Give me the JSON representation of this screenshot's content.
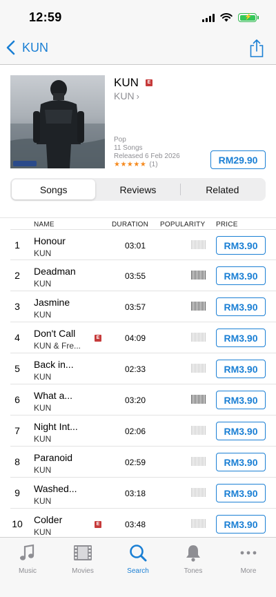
{
  "status": {
    "time": "12:59"
  },
  "nav": {
    "back_label": "KUN"
  },
  "album": {
    "title": "KUN",
    "explicit_label": "E",
    "artist": "KUN",
    "genre": "Pop",
    "song_count": "11 Songs",
    "released": "Released 6 Feb 2026",
    "stars": "★★★★★",
    "rating_count": "(1)",
    "price": "RM29.90"
  },
  "segments": [
    {
      "label": "Songs",
      "active": true
    },
    {
      "label": "Reviews",
      "active": false
    },
    {
      "label": "Related",
      "active": false
    }
  ],
  "table": {
    "columns": {
      "name": "NAME",
      "duration": "DURATION",
      "popularity": "POPULARITY",
      "price": "PRICE"
    },
    "rows": [
      {
        "num": "1",
        "title": "Honour",
        "artist": "KUN",
        "explicit": false,
        "duration": "03:01",
        "popularity": 0.0,
        "price": "RM3.90"
      },
      {
        "num": "2",
        "title": "Deadman",
        "artist": "KUN",
        "explicit": false,
        "duration": "03:55",
        "popularity": 1.0,
        "price": "RM3.90"
      },
      {
        "num": "3",
        "title": "Jasmine",
        "artist": "KUN",
        "explicit": false,
        "duration": "03:57",
        "popularity": 1.0,
        "price": "RM3.90"
      },
      {
        "num": "4",
        "title": "Don't Call",
        "artist": "KUN & Fre...",
        "explicit": true,
        "duration": "04:09",
        "popularity": 0.0,
        "price": "RM3.90"
      },
      {
        "num": "5",
        "title": "Back in...",
        "artist": "KUN",
        "explicit": false,
        "duration": "02:33",
        "popularity": 0.0,
        "price": "RM3.90"
      },
      {
        "num": "6",
        "title": "What a...",
        "artist": "KUN",
        "explicit": false,
        "duration": "03:20",
        "popularity": 1.0,
        "price": "RM3.90"
      },
      {
        "num": "7",
        "title": "Night Int...",
        "artist": "KUN",
        "explicit": false,
        "duration": "02:06",
        "popularity": 0.0,
        "price": "RM3.90"
      },
      {
        "num": "8",
        "title": "Paranoid",
        "artist": "KUN",
        "explicit": false,
        "duration": "02:59",
        "popularity": 0.0,
        "price": "RM3.90"
      },
      {
        "num": "9",
        "title": "Washed...",
        "artist": "KUN",
        "explicit": false,
        "duration": "03:18",
        "popularity": 0.0,
        "price": "RM3.90"
      },
      {
        "num": "10",
        "title": "Colder",
        "artist": "KUN",
        "explicit": true,
        "duration": "03:48",
        "popularity": 0.0,
        "price": "RM3.90"
      }
    ]
  },
  "tabbar": [
    {
      "label": "Music",
      "icon": "music-note-icon",
      "active": false
    },
    {
      "label": "Movies",
      "icon": "film-icon",
      "active": false
    },
    {
      "label": "Search",
      "icon": "search-icon",
      "active": true
    },
    {
      "label": "Tones",
      "icon": "bell-icon",
      "active": false
    },
    {
      "label": "More",
      "icon": "more-icon",
      "active": false
    }
  ],
  "colors": {
    "accent": "#1a7fd4",
    "explicit": "#c63b3b",
    "stars": "#f58a1f"
  }
}
